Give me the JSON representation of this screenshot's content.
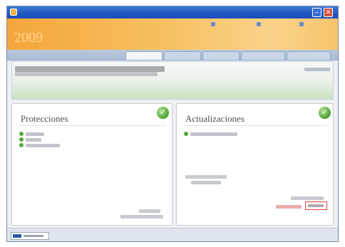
{
  "window": {
    "title": "",
    "minimize_glyph": "–",
    "close_glyph": "✕"
  },
  "banner": {
    "brand_small": "",
    "brand_word": "",
    "brand_year": "2009",
    "links": [
      "",
      "",
      ""
    ]
  },
  "tabs": [
    "",
    "",
    "",
    "",
    ""
  ],
  "active_tab_index": 0,
  "status": {
    "title": "",
    "subtitle": "",
    "link": ""
  },
  "protecciones": {
    "title": "Protecciones",
    "check_glyph": "✓",
    "items": [
      "",
      "",
      ""
    ],
    "configure_link": "",
    "configure_sub": ""
  },
  "actualizaciones": {
    "title": "Actualizaciones",
    "check_glyph": "✓",
    "items": [
      ""
    ],
    "info_text": "",
    "red_link": "",
    "update_button": ""
  },
  "colors": {
    "banner_orange": "#f4a63c",
    "status_green": "#53a83a",
    "highlight_red": "#e0443a",
    "titlebar_blue": "#1f56c2"
  }
}
